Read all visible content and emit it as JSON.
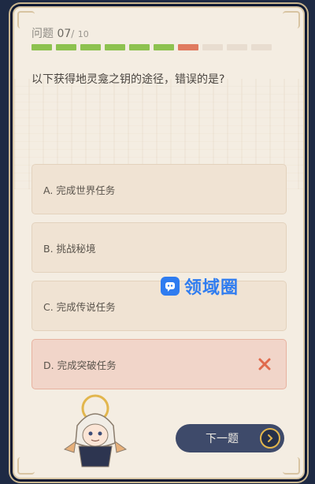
{
  "header": {
    "label": "问题",
    "current": "07",
    "separator": "/",
    "total": "10"
  },
  "progress": {
    "answered_correct": 6,
    "answered_wrong": 1,
    "remaining": 3,
    "colors": {
      "correct": "#8dc24f",
      "wrong": "#e07a5f",
      "remaining": "#e8ddd0"
    }
  },
  "question": {
    "text": "以下获得地灵龛之钥的途径，错误的是?"
  },
  "options": [
    {
      "label": "A. 完成世界任务",
      "state": "default"
    },
    {
      "label": "B. 挑战秘境",
      "state": "default"
    },
    {
      "label": "C. 完成传说任务",
      "state": "default"
    },
    {
      "label": "D. 完成突破任务",
      "state": "wrong"
    }
  ],
  "watermark": {
    "text": "领域圈",
    "icon": "chat-bubble-icon",
    "color": "#2f7cf0"
  },
  "next_button": {
    "label": "下一题",
    "icon": "chevron-right-icon"
  }
}
